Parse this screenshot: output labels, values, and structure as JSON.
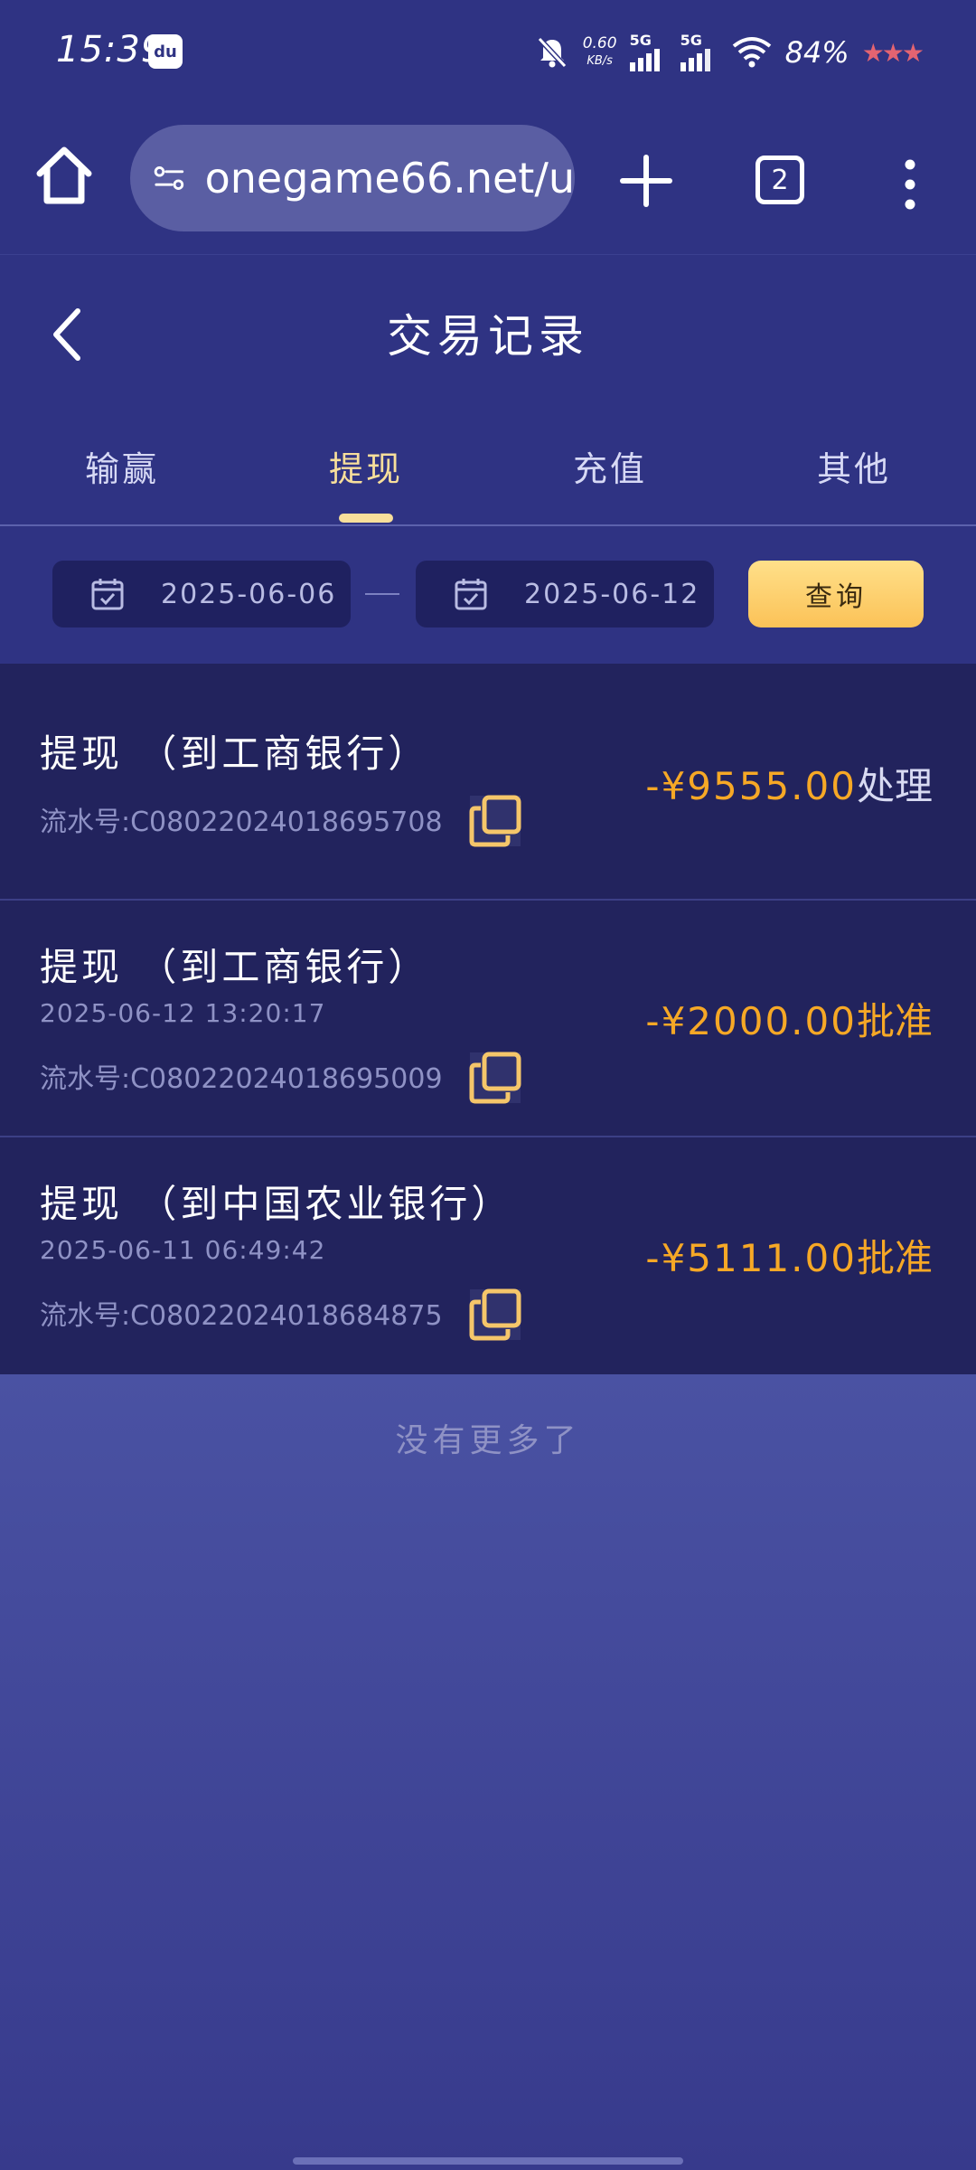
{
  "status_bar": {
    "time": "15:39",
    "app_icon_label": "du",
    "net_speed_value": "0.60",
    "net_speed_unit": "KB/s",
    "signal_1_label": "5G",
    "signal_2_label": "5G",
    "battery": "84%",
    "rating_stars": "★★★"
  },
  "browser": {
    "url": "onegame66.net/u",
    "tab_count": "2"
  },
  "header": {
    "title": "交易记录"
  },
  "tabs": [
    {
      "label": "输赢"
    },
    {
      "label": "提现"
    },
    {
      "label": "充值"
    },
    {
      "label": "其他"
    }
  ],
  "active_tab": "提现",
  "filter": {
    "start_date": "2025-06-06",
    "end_date": "2025-06-12",
    "query_label": "查询"
  },
  "records": [
    {
      "title": "提现 （到工商银行）",
      "time": "",
      "serial": "流水号:C08022024018695708",
      "amount": "-¥9555.00",
      "status": "处理"
    },
    {
      "title": "提现 （到工商银行）",
      "time": "2025-06-12 13:20:17",
      "serial": "流水号:C08022024018695009",
      "amount": "-¥2000.00",
      "status": "批准"
    },
    {
      "title": "提现 （到中国农业银行）",
      "time": "2025-06-11 06:49:42",
      "serial": "流水号:C08022024018684875",
      "amount": "-¥5111.00",
      "status": "批准"
    }
  ],
  "footer": {
    "no_more": "没有更多了"
  },
  "colors": {
    "background": "#2f3383",
    "record_bg": "#22235d",
    "accent_gold": "#f6a826",
    "active_tab": "#f8df9b"
  }
}
